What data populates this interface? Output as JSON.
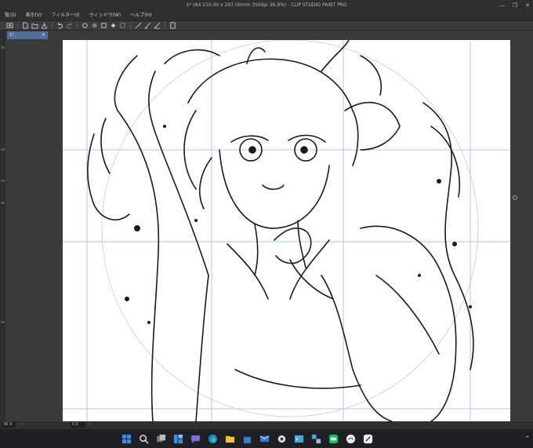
{
  "window": {
    "title": "1* (A4 210.00 x 297.00mm 350dpi 36.9%) - CLIP STUDIO PAINT PRO",
    "controls": [
      "—",
      "❐",
      "✕"
    ]
  },
  "menu": [
    "覧(S)",
    "表示(V)",
    "フィルター(I)",
    "ウィンドウ(W)",
    "ヘルプ(H)"
  ],
  "tab": {
    "label": "1*",
    "close": "×"
  },
  "status": {
    "zoom": "36.9",
    "angle": "0.0",
    "navs": "‹ ›",
    "navs2": "‹ ›"
  },
  "tray": {
    "chevron": "^"
  },
  "colors": {
    "chrome": "#2f2f2f",
    "canvas_bg": "#3a3a3a",
    "tab_active": "#4f6e9a",
    "guide": "#8fb0e8",
    "lineart": "#1a1a1a"
  },
  "taskbar_icons": [
    "windows-start-icon",
    "search-icon",
    "task-view-icon",
    "widgets-icon",
    "chat-icon",
    "edge-icon",
    "file-explorer-icon",
    "store-icon",
    "mail-icon",
    "settings-icon",
    "terminal-icon",
    "multiapp-icon",
    "line-icon",
    "clipstudio-icon",
    "clipstudio-paint-icon"
  ]
}
